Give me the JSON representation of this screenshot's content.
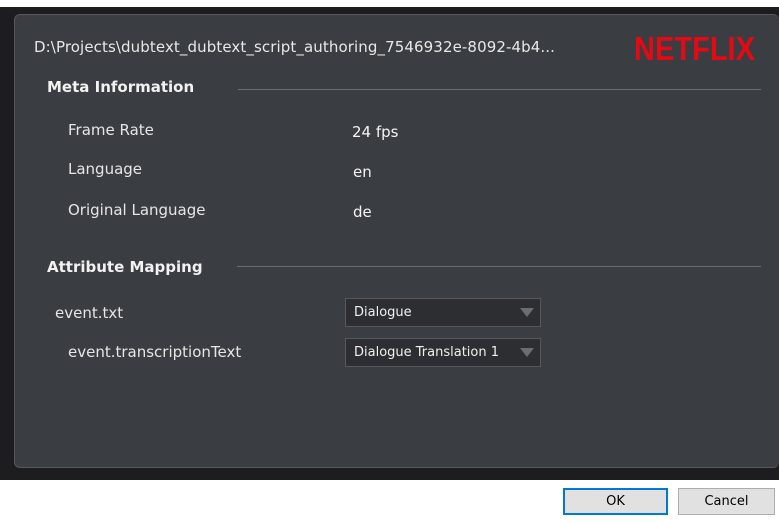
{
  "window": {
    "file_path": "D:\\Projects\\dubtext_dubtext_script_authoring_7546932e-8092-4b4...",
    "logo_text": "NETFLIX",
    "logo_color": "#e50914"
  },
  "meta": {
    "title": "Meta Information",
    "rows": [
      {
        "label": "Frame Rate",
        "value": "24 fps"
      },
      {
        "label": "Language",
        "value": "en"
      },
      {
        "label": "Original Language",
        "value": "de"
      }
    ]
  },
  "mapping": {
    "title": "Attribute Mapping",
    "rows": [
      {
        "label": "event.txt",
        "selected": "Dialogue"
      },
      {
        "label": "event.transcriptionText",
        "selected": "Dialogue Translation 1"
      }
    ]
  },
  "buttons": {
    "ok_label": "OK",
    "cancel_label": "Cancel"
  },
  "icons": {
    "dropdown": "chevron-down-icon"
  }
}
